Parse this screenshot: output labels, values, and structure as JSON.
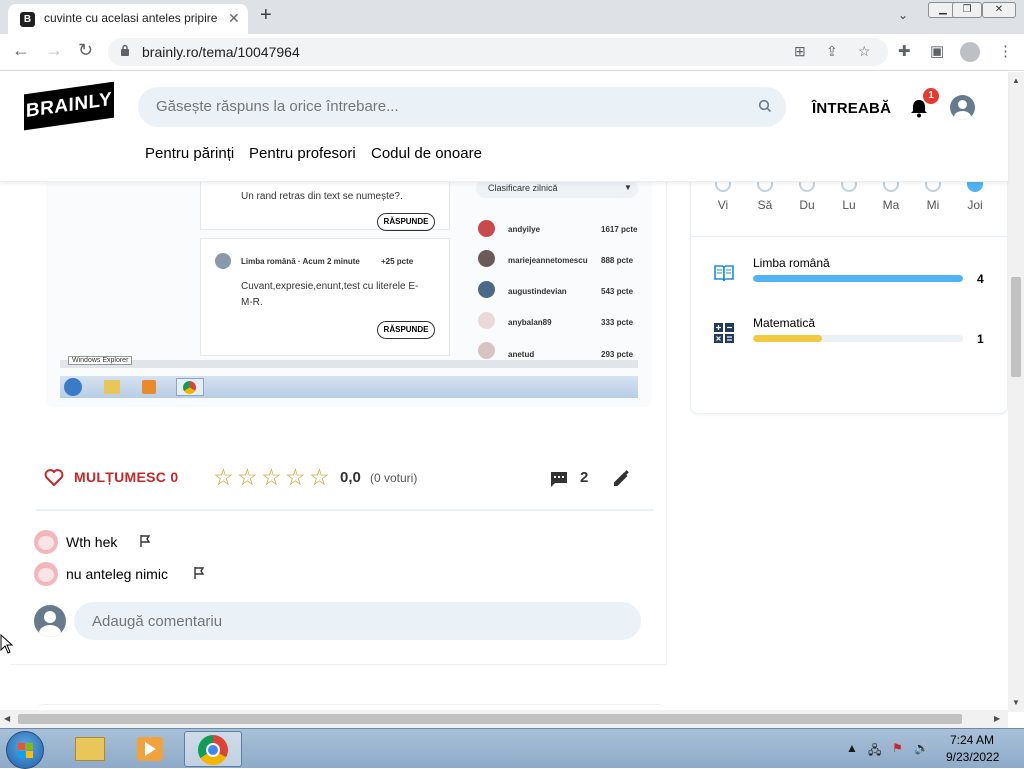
{
  "browser": {
    "tab_title": "cuvinte cu acelasi anteles pripire",
    "favicon_letter": "B",
    "tab_close": "✕",
    "new_tab": "+",
    "url": "brainly.ro/tema/10047964"
  },
  "header": {
    "logo": "BRAINLY",
    "search_placeholder": "Găsește răspuns la orice întrebare...",
    "ask_label": "ÎNTREABĂ",
    "notification_count": "1",
    "nav": [
      "Pentru părinți",
      "Pentru profesori",
      "Codul de onoare"
    ]
  },
  "embedded_screenshot": {
    "question1_text": "Un rand retras din text se numește?.",
    "answer_button": "RĂSPUNDE",
    "question2_meta": "Limba română · Acum 2 minute",
    "question2_points": "+25 pcte",
    "question2_text_line1": "Cuvant,expresie,enunt,test cu literele E-",
    "question2_text_line2": "M-R.",
    "ranking_select": "Clasificare zilnică",
    "ranking": [
      {
        "user": "andyilye",
        "points": "1617 pcte"
      },
      {
        "user": "mariejeannetomescu",
        "points": "888 pcte"
      },
      {
        "user": "augustindevian",
        "points": "543 pcte"
      },
      {
        "user": "anybalan89",
        "points": "333 pcte"
      },
      {
        "user": "anetud",
        "points": "293 pcte"
      }
    ],
    "taskbar_tooltip": "Windows Explorer"
  },
  "answer": {
    "thanks_label": "MULȚUMESC 0",
    "rating_value": "0,0",
    "votes": "(0 voturi)",
    "comment_count": "2",
    "star_count": 5,
    "star_glyph": "☆"
  },
  "comments": [
    {
      "text": "Wth hek"
    },
    {
      "text": "nu anteleg nimic"
    }
  ],
  "add_comment_placeholder": "Adaugă comentariu",
  "side_panel": {
    "days": [
      {
        "label": "Vi",
        "active": false
      },
      {
        "label": "Să",
        "active": false
      },
      {
        "label": "Du",
        "active": false
      },
      {
        "label": "Lu",
        "active": false
      },
      {
        "label": "Ma",
        "active": false
      },
      {
        "label": "Mi",
        "active": false
      },
      {
        "label": "Joi",
        "active": true
      }
    ],
    "subjects": [
      {
        "label": "Limba română",
        "count": "4",
        "progress": 1.0,
        "color": "#4fb3f6",
        "icon": "book-icon"
      },
      {
        "label": "Matematică",
        "count": "1",
        "progress": 0.33,
        "color": "#f5c842",
        "icon": "calculator-icon"
      }
    ]
  },
  "taskbar": {
    "time": "7:24 AM",
    "date": "9/23/2022",
    "apps": [
      "explorer",
      "media-player",
      "chrome"
    ]
  },
  "colors": {
    "brand_red": "#c62828",
    "search_bg": "#ebf2f7",
    "badge": "#e8392f"
  }
}
